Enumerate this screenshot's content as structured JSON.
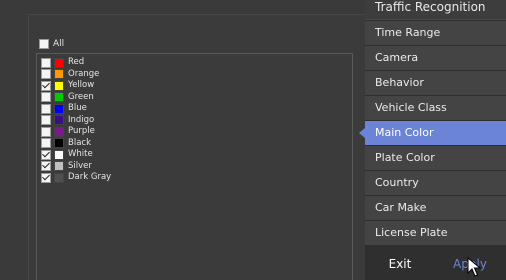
{
  "filter": {
    "all_label": "All",
    "all_checked": false,
    "colors": [
      {
        "label": "Red",
        "swatch": "#ff0000",
        "checked": false
      },
      {
        "label": "Orange",
        "swatch": "#ff9900",
        "checked": false
      },
      {
        "label": "Yellow",
        "swatch": "#ffff00",
        "checked": true
      },
      {
        "label": "Green",
        "swatch": "#00cc00",
        "checked": false
      },
      {
        "label": "Blue",
        "swatch": "#0000ff",
        "checked": false
      },
      {
        "label": "Indigo",
        "swatch": "#3a0f8a",
        "checked": false
      },
      {
        "label": "Purple",
        "swatch": "#7a1a8c",
        "checked": false
      },
      {
        "label": "Black",
        "swatch": "#000000",
        "checked": false
      },
      {
        "label": "White",
        "swatch": "#ffffff",
        "checked": true
      },
      {
        "label": "Silver",
        "swatch": "#c0c0c0",
        "checked": true
      },
      {
        "label": "Dark Gray",
        "swatch": "#505050",
        "checked": true
      }
    ]
  },
  "menu": {
    "title": "Traffic Recognition",
    "items": [
      {
        "label": "Time Range",
        "active": false
      },
      {
        "label": "Camera",
        "active": false
      },
      {
        "label": "Behavior",
        "active": false
      },
      {
        "label": "Vehicle Class",
        "active": false
      },
      {
        "label": "Main Color",
        "active": true
      },
      {
        "label": "Plate Color",
        "active": false
      },
      {
        "label": "Country",
        "active": false
      },
      {
        "label": "Car Make",
        "active": false
      },
      {
        "label": "License Plate",
        "active": false
      }
    ],
    "exit_label": "Exit",
    "apply_label": "Apply"
  },
  "theme": {
    "accent": "#6b84d6"
  }
}
